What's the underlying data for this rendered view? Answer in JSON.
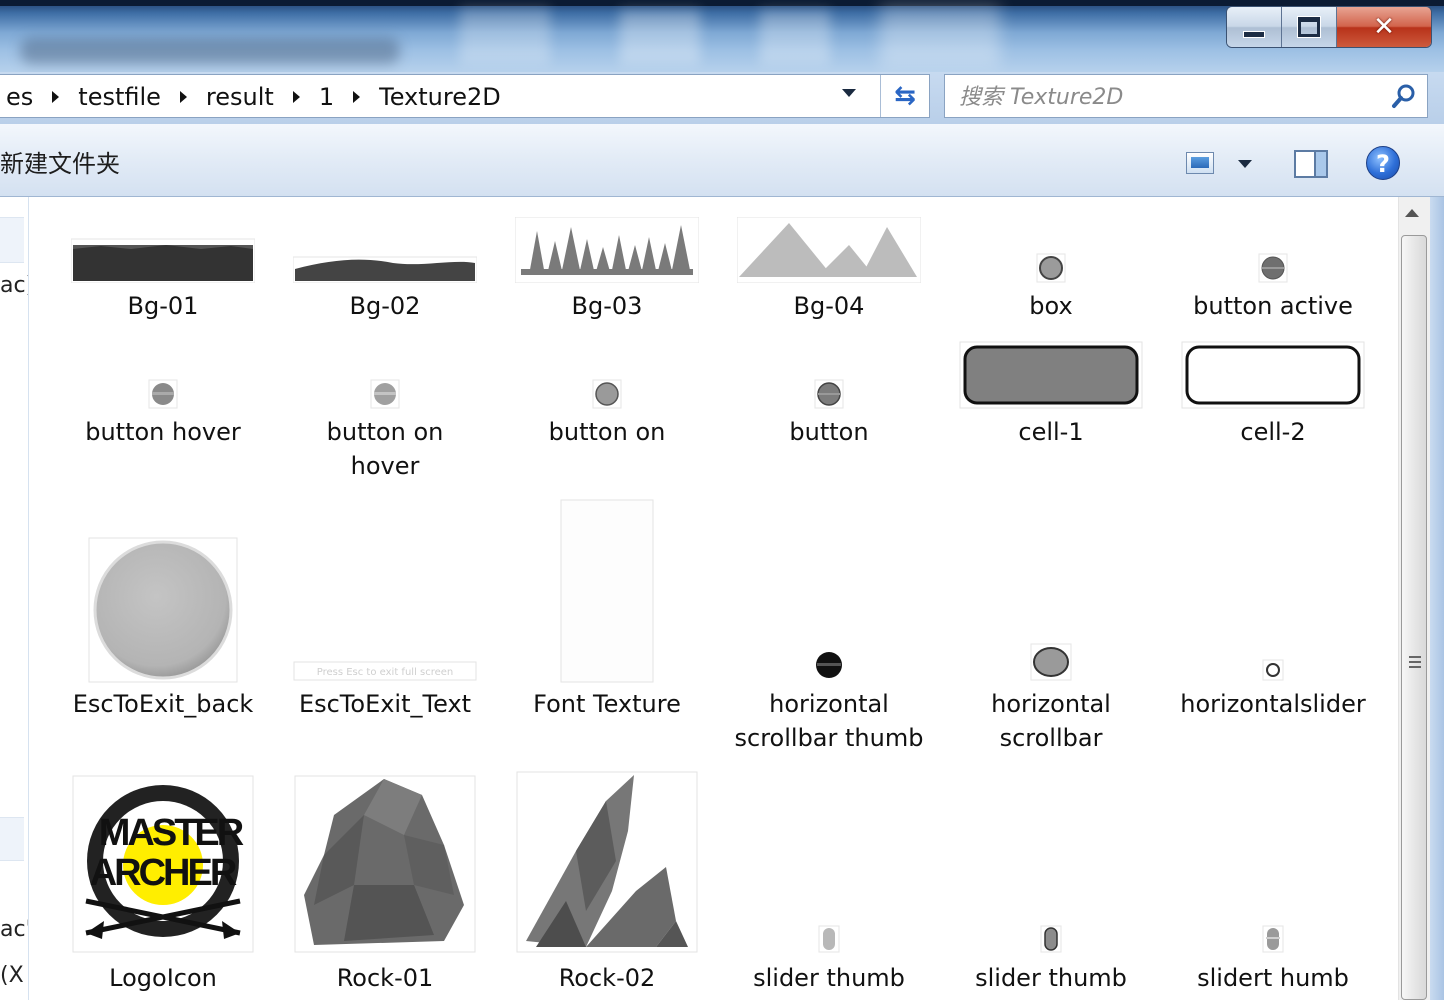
{
  "window": {
    "controls": [
      "minimize",
      "maximize",
      "close"
    ]
  },
  "address_bar": {
    "crumbs": [
      "es",
      "testfile",
      "result",
      "1",
      "Texture2D"
    ]
  },
  "search": {
    "placeholder": "搜索 Texture2D"
  },
  "toolbar": {
    "new_folder_label": "新建文件夹",
    "help_label": "?"
  },
  "nav_pane": {
    "fragments": [
      "ac)",
      "ac'",
      "(X"
    ]
  },
  "files": [
    {
      "name": "Bg-01",
      "thumb": "bg-dark-strip"
    },
    {
      "name": "Bg-02",
      "thumb": "bg-hills-strip"
    },
    {
      "name": "Bg-03",
      "thumb": "bg-trees"
    },
    {
      "name": "Bg-04",
      "thumb": "bg-mountains"
    },
    {
      "name": "box",
      "thumb": "small-dot"
    },
    {
      "name": "button active",
      "thumb": "small-dot-dark"
    },
    {
      "name": "button hover",
      "thumb": "small-dot"
    },
    {
      "name": "button on hover",
      "label_lines": [
        "button on",
        "hover"
      ],
      "thumb": "small-dot"
    },
    {
      "name": "button on",
      "thumb": "small-dot"
    },
    {
      "name": "button",
      "thumb": "small-dot"
    },
    {
      "name": "cell-1",
      "thumb": "rounded-rect-gray"
    },
    {
      "name": "cell-2",
      "thumb": "rounded-rect-white"
    },
    {
      "name": "EscToExit_back",
      "thumb": "gray-circle"
    },
    {
      "name": "EscToExit_Text",
      "thumb": "thin-text-strip",
      "thumb_text": "Press Esc to exit full screen"
    },
    {
      "name": "Font Texture",
      "thumb": "white-tall"
    },
    {
      "name": "horizontal scrollbar thumb",
      "label_lines": [
        "horizontal",
        "scrollbar thumb"
      ],
      "thumb": "black-dot"
    },
    {
      "name": "horizontal scrollbar",
      "label_lines": [
        "horizontal",
        "scrollbar"
      ],
      "thumb": "gray-oval"
    },
    {
      "name": "horizontalslider",
      "thumb": "tiny-ring"
    },
    {
      "name": "LogoIcon",
      "thumb": "logo",
      "logo_lines": [
        "MASTER",
        "ARCHER"
      ]
    },
    {
      "name": "Rock-01",
      "thumb": "rock1"
    },
    {
      "name": "Rock-02",
      "thumb": "rock2"
    },
    {
      "name": "slider thumb",
      "thumb": "tiny-pill-light"
    },
    {
      "name": "slider thumb",
      "thumb": "tiny-pill"
    },
    {
      "name": "slidert humb",
      "thumb": "tiny-pill"
    }
  ],
  "colors": {
    "title_bar": "#7ea8d4",
    "close_button": "#c9432a",
    "toolbar": "#e2ebf6",
    "selection": "#eef3fa"
  }
}
